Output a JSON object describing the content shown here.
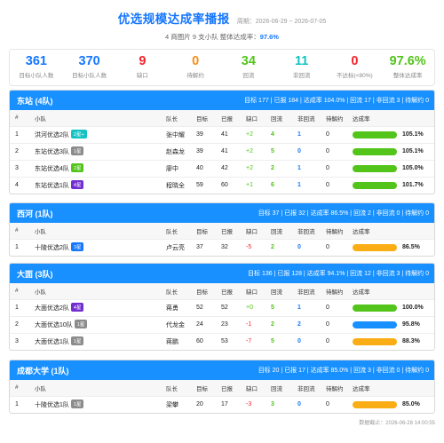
{
  "header": {
    "title": "优选规模达成率播报",
    "period": "周期：2026-06-29 ~ 2026-07-05",
    "sub_prefix": "4 商圈片 9 支小队 整体达成率：",
    "overall_rate": "97.6%"
  },
  "stats": [
    {
      "value": "361",
      "label": "目标小队人数",
      "color": "#1677ff"
    },
    {
      "value": "370",
      "label": "目标小队人数",
      "color": "#1677ff"
    },
    {
      "value": "9",
      "label": "缺口",
      "color": "#f5222d"
    },
    {
      "value": "0",
      "label": "待解约",
      "color": "#fa8c16"
    },
    {
      "value": "34",
      "label": "回流",
      "color": "#52c41a"
    },
    {
      "value": "11",
      "label": "非回流",
      "color": "#13c2c2"
    },
    {
      "value": "0",
      "label": "不达标(<80%)",
      "color": "#f5222d"
    },
    {
      "value": "97.6%",
      "label": "整体达成率",
      "color": "#52c41a"
    }
  ],
  "columns": [
    "#",
    "小队",
    "队长",
    "目标",
    "已报",
    "缺口",
    "回流",
    "非回流",
    "待解约",
    "达成率"
  ],
  "sections": [
    {
      "name": "东站 (4队)",
      "summary": "目标 177 | 已报 184 | 达成率 104.0% | 回流 17 | 非回流 3 | 待解约 0",
      "rows": [
        {
          "idx": "1",
          "team": "洪河优选2队",
          "tag": "2星+",
          "tag_color": "#13c2c2",
          "leader": "张中耀",
          "target": "39",
          "reported": "41",
          "gap": "+2",
          "gap_cls": "g",
          "back": "4",
          "nonback": "1",
          "pending": "0",
          "rate": 105.1,
          "rate_text": "105.1%",
          "bar_color": "#52c41a"
        },
        {
          "idx": "2",
          "team": "东站优选3队",
          "tag": "1星",
          "tag_color": "#8c8c8c",
          "leader": "赵森龙",
          "target": "39",
          "reported": "41",
          "gap": "+2",
          "gap_cls": "g",
          "back": "5",
          "nonback": "0",
          "pending": "0",
          "rate": 105.1,
          "rate_text": "105.1%",
          "bar_color": "#52c41a"
        },
        {
          "idx": "3",
          "team": "东站优选4队",
          "tag": "2星",
          "tag_color": "#52c41a",
          "leader": "廖中",
          "target": "40",
          "reported": "42",
          "gap": "+2",
          "gap_cls": "g",
          "back": "2",
          "nonback": "1",
          "pending": "0",
          "rate": 105.0,
          "rate_text": "105.0%",
          "bar_color": "#52c41a"
        },
        {
          "idx": "4",
          "team": "东站优选1队",
          "tag": "4星",
          "tag_color": "#722ed1",
          "leader": "程晓全",
          "target": "59",
          "reported": "60",
          "gap": "+1",
          "gap_cls": "g",
          "back": "6",
          "nonback": "1",
          "pending": "0",
          "rate": 101.7,
          "rate_text": "101.7%",
          "bar_color": "#52c41a"
        }
      ]
    },
    {
      "name": "西河 (1队)",
      "summary": "目标 37 | 已报 32 | 达成率 86.5% | 回流 2 | 非回流 0 | 待解约 0",
      "rows": [
        {
          "idx": "1",
          "team": "十陵优选2队",
          "tag": "3星",
          "tag_color": "#1677ff",
          "leader": "卢云亮",
          "target": "37",
          "reported": "32",
          "gap": "-5",
          "gap_cls": "r",
          "back": "2",
          "nonback": "0",
          "pending": "0",
          "rate": 86.5,
          "rate_text": "86.5%",
          "bar_color": "#faad14"
        }
      ]
    },
    {
      "name": "大面 (3队)",
      "summary": "目标 136 | 已报 128 | 达成率 94.1% | 回流 12 | 非回流 3 | 待解约 0",
      "rows": [
        {
          "idx": "1",
          "team": "大面优选2队",
          "tag": "4星",
          "tag_color": "#722ed1",
          "leader": "蒋勇",
          "target": "52",
          "reported": "52",
          "gap": "+0",
          "gap_cls": "g",
          "back": "5",
          "nonback": "1",
          "pending": "0",
          "rate": 100.0,
          "rate_text": "100.0%",
          "bar_color": "#52c41a"
        },
        {
          "idx": "2",
          "team": "大面优选10队",
          "tag": "1星",
          "tag_color": "#8c8c8c",
          "leader": "代龙金",
          "target": "24",
          "reported": "23",
          "gap": "-1",
          "gap_cls": "r",
          "back": "2",
          "nonback": "2",
          "pending": "0",
          "rate": 95.8,
          "rate_text": "95.8%",
          "bar_color": "#1890ff"
        },
        {
          "idx": "3",
          "team": "大面优选1队",
          "tag": "1星",
          "tag_color": "#8c8c8c",
          "leader": "蒋鹏",
          "target": "60",
          "reported": "53",
          "gap": "-7",
          "gap_cls": "r",
          "back": "5",
          "nonback": "0",
          "pending": "0",
          "rate": 88.3,
          "rate_text": "88.3%",
          "bar_color": "#faad14"
        }
      ]
    },
    {
      "name": "成都大学 (1队)",
      "summary": "目标 20 | 已报 17 | 达成率 85.0% | 回流 3 | 非回流 0 | 待解约 0",
      "rows": [
        {
          "idx": "1",
          "team": "十陵优选1队",
          "tag": "1星",
          "tag_color": "#8c8c8c",
          "leader": "梁攀",
          "target": "20",
          "reported": "17",
          "gap": "-3",
          "gap_cls": "r",
          "back": "3",
          "nonback": "0",
          "pending": "0",
          "rate": 85.0,
          "rate_text": "85.0%",
          "bar_color": "#faad14"
        }
      ]
    }
  ],
  "footer": "数据截止：2026-06-28 14:00:55"
}
